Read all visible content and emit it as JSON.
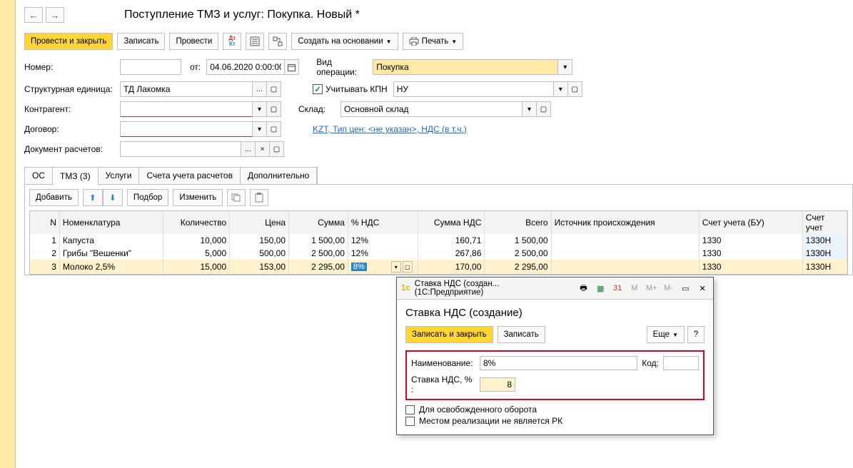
{
  "title": "Поступление ТМЗ и услуг: Покупка. Новый *",
  "toolbar": {
    "post_close": "Провести и закрыть",
    "save": "Записать",
    "post": "Провести",
    "create_based": "Создать на основании",
    "print": "Печать"
  },
  "form": {
    "number_label": "Номер:",
    "number_value": "",
    "from_label": "от:",
    "date_value": "04.06.2020 0:00:00",
    "unit_label": "Структурная единица:",
    "unit_value": "ТД Лакомка",
    "contr_label": "Контрагент:",
    "contr_value": "",
    "contract_label": "Договор:",
    "contract_value": "",
    "docr_label": "Документ расчетов:",
    "docr_value": "",
    "op_label": "Вид операции:",
    "op_value": "Покупка",
    "kpn_label": "Учитывать КПН",
    "kpn_value": "НУ",
    "wh_label": "Склад:",
    "wh_value": "Основной склад",
    "price_link": "KZT, Тип цен: <не указан>, НДС (в т.ч.)"
  },
  "tabs": {
    "t1": "ОС",
    "t2": "ТМЗ (3)",
    "t3": "Услуги",
    "t4": "Счета учета расчетов",
    "t5": "Дополнительно"
  },
  "sub": {
    "add": "Добавить",
    "pick": "Подбор",
    "edit": "Изменить"
  },
  "cols": {
    "n": "N",
    "nom": "Номенклатура",
    "qty": "Количество",
    "price": "Цена",
    "sum": "Сумма",
    "nds": "% НДС",
    "nds_sum": "Сумма НДС",
    "total": "Всего",
    "src": "Источник происхождения",
    "acc_bu": "Счет учета (БУ)",
    "acc_nu": "Счет учет"
  },
  "rows": [
    {
      "n": "1",
      "nom": "Капуста",
      "qty": "10,000",
      "price": "150,00",
      "sum": "1 500,00",
      "nds": "12%",
      "nds_sum": "160,71",
      "total": "1 500,00",
      "acc_bu": "1330",
      "acc_nu": "1330Н"
    },
    {
      "n": "2",
      "nom": "Грибы \"Вешенки\"",
      "qty": "5,000",
      "price": "500,00",
      "sum": "2 500,00",
      "nds": "12%",
      "nds_sum": "267,86",
      "total": "2 500,00",
      "acc_bu": "1330",
      "acc_nu": "1330Н"
    },
    {
      "n": "3",
      "nom": "Молоко 2,5%",
      "qty": "15,000",
      "price": "153,00",
      "sum": "2 295,00",
      "nds": "8%",
      "nds_sum": "170,00",
      "total": "2 295,00",
      "acc_bu": "1330",
      "acc_nu": "1330Н"
    }
  ],
  "dialog": {
    "window_title": "Ставка НДС (создан...   (1С:Предприятие)",
    "heading": "Ставка НДС (создание)",
    "save_close": "Записать и закрыть",
    "save": "Записать",
    "more": "Еще",
    "name_label": "Наименование:",
    "name_value": "8%",
    "code_label": "Код:",
    "code_value": "",
    "rate_label": "Ставка НДС, % :",
    "rate_value": "8",
    "chk1": "Для освобожденного оборота",
    "chk2": "Местом реализации не является РК"
  }
}
